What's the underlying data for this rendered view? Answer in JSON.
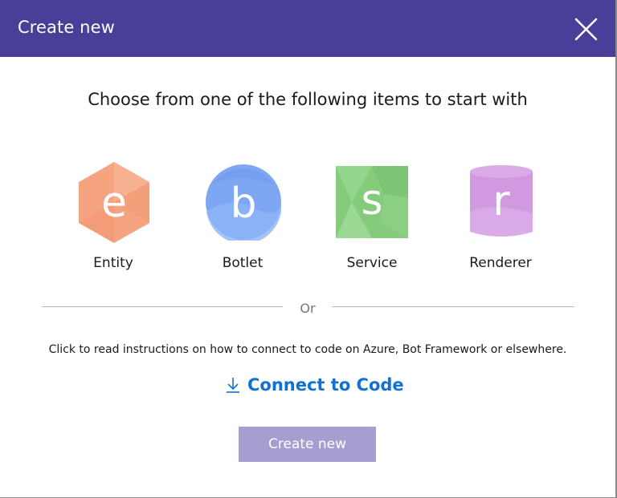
{
  "dialog": {
    "title": "Create new",
    "close_icon": "close-icon",
    "headline": "Choose from one of the following items to start with",
    "items": [
      {
        "letter": "e",
        "label": "Entity",
        "shape": "hexagon",
        "color": "#f5a47f"
      },
      {
        "letter": "b",
        "label": "Botlet",
        "shape": "circle",
        "color": "#7ea6f3"
      },
      {
        "letter": "s",
        "label": "Service",
        "shape": "square",
        "color": "#84cb7c"
      },
      {
        "letter": "r",
        "label": "Renderer",
        "shape": "cylinder",
        "color": "#d19ae0"
      }
    ],
    "divider_text": "Or",
    "instructions": "Click to read instructions on how to connect to code on Azure, Bot Framework or elsewhere.",
    "connect_link": {
      "icon": "download-arrow-icon",
      "label": "Connect to Code"
    },
    "create_button": {
      "label": "Create new"
    }
  },
  "colors": {
    "titlebar": "#4a3f98",
    "link": "#1170d6",
    "button_disabled": "#a59ed0"
  }
}
